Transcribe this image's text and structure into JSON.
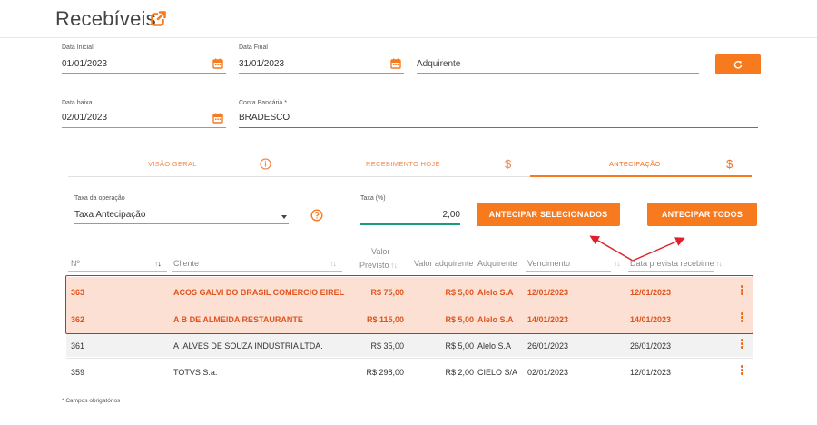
{
  "page": {
    "title": "Recebíveis"
  },
  "filters": {
    "data_inicial": {
      "label": "Data Inicial",
      "value": "01/01/2023"
    },
    "data_final": {
      "label": "Data Final",
      "value": "31/01/2023"
    },
    "adquirente": {
      "placeholder": "Adquirente"
    },
    "data_baixa": {
      "label": "Data baixa",
      "value": "02/01/2023"
    },
    "conta_bancaria": {
      "label": "Conta Bancária *",
      "value": "BRADESCO"
    }
  },
  "tabs": [
    {
      "label": "VISÃO GERAL",
      "icon": "info-icon",
      "active": false
    },
    {
      "label": "RECEBIMENTO HOJE",
      "icon": "dollar-icon",
      "active": false
    },
    {
      "label": "ANTECIPAÇÃO",
      "icon": "dollar-icon",
      "active": true
    }
  ],
  "operation": {
    "taxa_operacao": {
      "label": "Taxa da operação",
      "value": "Taxa Antecipação"
    },
    "taxa_percent": {
      "label": "Taxa (%)",
      "value": "2,00"
    },
    "btn_selecionados": "ANTECIPAR SELECIONADOS",
    "btn_todos": "ANTECIPAR TODOS"
  },
  "table": {
    "headers": {
      "numero": "Nº",
      "cliente": "Cliente",
      "valor_previsto_1": "Valor",
      "valor_previsto_2": "Previsto",
      "valor_adquirente": "Valor adquirente",
      "adquirente": "Adquirente",
      "vencimento": "Vencimento",
      "data_prevista": "Data prevista recebime"
    },
    "rows": [
      {
        "numero": "363",
        "cliente": "ACOS GALVI DO BRASIL COMERCIO EIREL",
        "valor_previsto": "R$ 75,00",
        "valor_adquirente": "R$ 5,00",
        "adquirente": "Alelo S.A",
        "vencimento": "12/01/2023",
        "data_prevista": "12/01/2023"
      },
      {
        "numero": "362",
        "cliente": "A B DE ALMEIDA RESTAURANTE",
        "valor_previsto": "R$ 115,00",
        "valor_adquirente": "R$ 5,00",
        "adquirente": "Alelo S.A",
        "vencimento": "14/01/2023",
        "data_prevista": "14/01/2023"
      },
      {
        "numero": "361",
        "cliente": "A .ALVES DE SOUZA INDUSTRIA LTDA.",
        "valor_previsto": "R$ 35,00",
        "valor_adquirente": "R$ 5,00",
        "adquirente": "Alelo S.A",
        "vencimento": "26/01/2023",
        "data_prevista": "26/01/2023"
      },
      {
        "numero": "359",
        "cliente": "TOTVS S.a.",
        "valor_previsto": "R$ 298,00",
        "valor_adquirente": "R$ 2,00",
        "adquirente": "CIELO S/A",
        "vencimento": "02/01/2023",
        "data_prevista": "12/01/2023"
      }
    ]
  },
  "footer": {
    "note": "* Campos obrigatórios"
  },
  "colors": {
    "accent": "#f77a1f",
    "highlight_row": "#fce0d3",
    "annotation_red": "#e0202a",
    "focus_green": "#1a9c7a"
  }
}
